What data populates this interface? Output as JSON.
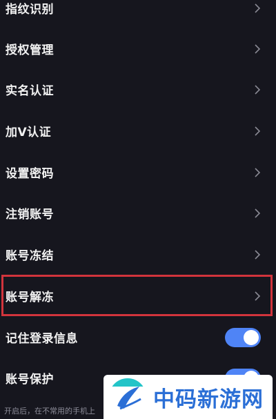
{
  "settings": {
    "items": [
      {
        "label": "指纹识别",
        "control": "chevron"
      },
      {
        "label": "授权管理",
        "control": "chevron"
      },
      {
        "label": "实名认证",
        "control": "chevron"
      },
      {
        "label": "加V认证",
        "control": "chevron"
      },
      {
        "label": "设置密码",
        "control": "chevron"
      },
      {
        "label": "注销账号",
        "control": "chevron"
      },
      {
        "label": "账号冻结",
        "control": "chevron"
      },
      {
        "label": "账号解冻",
        "control": "chevron",
        "highlighted": true
      },
      {
        "label": "记住登录信息",
        "control": "toggle",
        "on": true
      },
      {
        "label": "账号保护",
        "control": "toggle",
        "on": true
      }
    ],
    "footnote": "开启后，在不常用的手机上"
  },
  "watermark": {
    "text": "中码新游网"
  },
  "colors": {
    "background": "#16161e",
    "toggle_on": "#4f84f6",
    "highlight_border": "#d2343c",
    "watermark_blue": "#2b6fd6"
  }
}
